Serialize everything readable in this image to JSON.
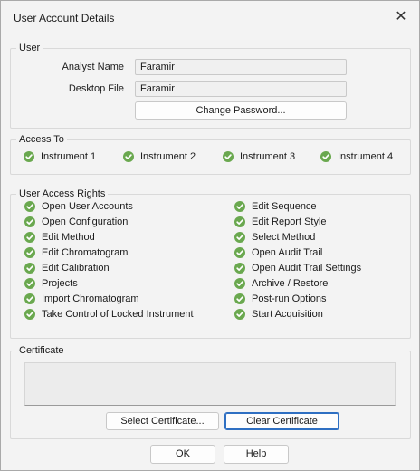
{
  "window": {
    "title": "User Account Details",
    "close_glyph": "✕"
  },
  "user_group": {
    "legend": "User",
    "analyst_label": "Analyst Name",
    "analyst_value": "Faramir",
    "desktop_label": "Desktop File",
    "desktop_value": "Faramir",
    "change_password_label": "Change Password..."
  },
  "access_group": {
    "legend": "Access To",
    "items": [
      "Instrument 1",
      "Instrument 2",
      "Instrument 3",
      "Instrument 4"
    ]
  },
  "rights_group": {
    "legend": "User Access Rights",
    "left": [
      "Open User Accounts",
      "Open Configuration",
      "Edit Method",
      "Edit Chromatogram",
      "Edit Calibration",
      "Projects",
      "Import Chromatogram",
      "Take Control of Locked Instrument"
    ],
    "right": [
      "Edit Sequence",
      "Edit Report Style",
      "Select Method",
      "Open Audit Trail",
      "Open Audit Trail Settings",
      "Archive / Restore",
      "Post-run Options",
      "Start Acquisition"
    ]
  },
  "certificate_group": {
    "legend": "Certificate",
    "select_label": "Select Certificate...",
    "clear_label": "Clear Certificate"
  },
  "footer": {
    "ok_label": "OK",
    "help_label": "Help"
  },
  "colors": {
    "check_green": "#6aa84f",
    "accent_blue": "#2e6fc2"
  },
  "icons": {
    "granted": "check-circle-icon"
  }
}
